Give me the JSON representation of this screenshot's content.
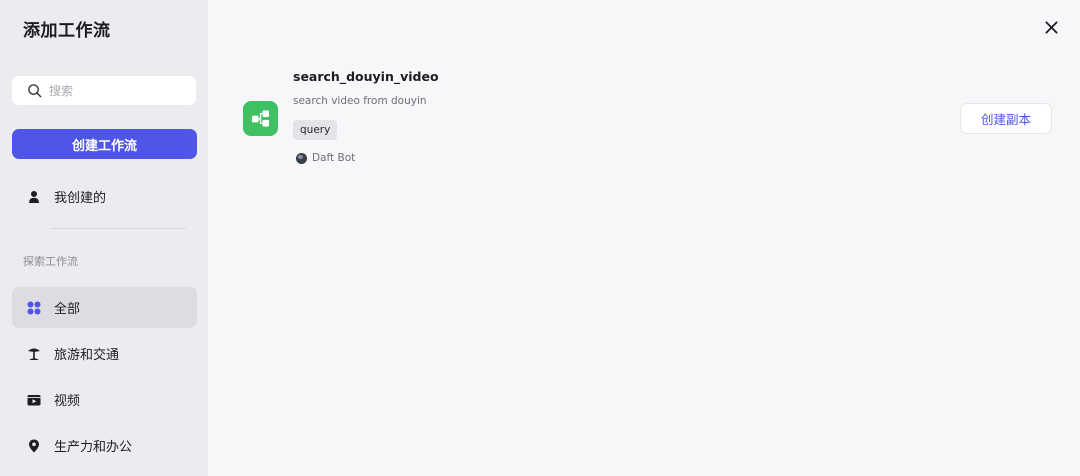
{
  "sidebar": {
    "title": "添加工作流",
    "search": {
      "placeholder": "搜索",
      "value": ""
    },
    "create_button": "创建工作流",
    "my_created": "我创建的",
    "section_label": "探索工作流",
    "categories": [
      {
        "label": "全部",
        "icon": "grid-icon",
        "active": true
      },
      {
        "label": "旅游和交通",
        "icon": "palm-tree-icon",
        "active": false
      },
      {
        "label": "视频",
        "icon": "video-icon",
        "active": false
      },
      {
        "label": "生产力和办公",
        "icon": "location-pin-icon",
        "active": false
      }
    ]
  },
  "workflow": {
    "name": "search_douyin_video",
    "description": "search video from douyin",
    "tag": "query",
    "author": "Daft Bot",
    "icon": "workflow-icon",
    "copy_button": "创建副本"
  },
  "colors": {
    "accent": "#4f55e6",
    "icon_green": "#3fc063",
    "sidebar_bg": "#ebebf0",
    "main_bg": "#f7f7fa"
  }
}
